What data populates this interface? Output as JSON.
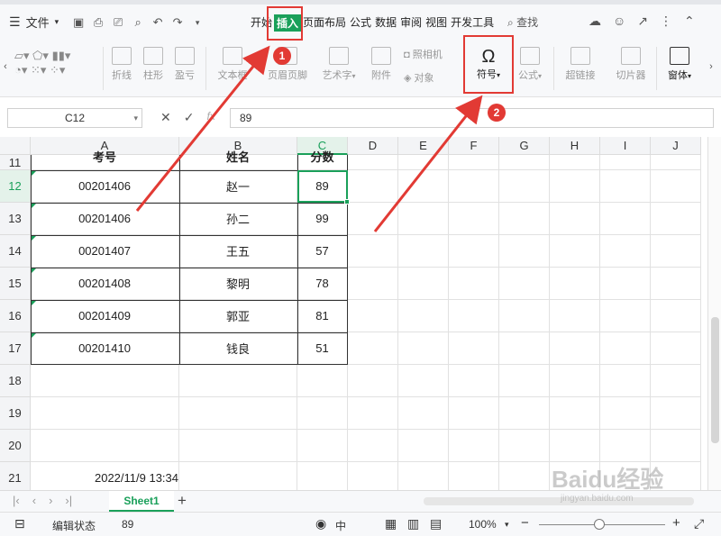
{
  "menubar": {
    "file_label": "文件",
    "tabs": [
      "开始",
      "插入",
      "页面布局",
      "公式",
      "数据",
      "审阅",
      "视图",
      "开发工具"
    ],
    "active_tab_index": 1,
    "search_label": "查找"
  },
  "ribbon": {
    "items": [
      {
        "label": "折线",
        "icon": "line-chart-icon"
      },
      {
        "label": "柱形",
        "icon": "bar-chart-icon"
      },
      {
        "label": "盈亏",
        "icon": "win-loss-icon"
      },
      {
        "label": "文本框",
        "icon": "textbox-icon"
      },
      {
        "label": "页眉页脚",
        "icon": "header-footer-icon"
      },
      {
        "label": "艺术字",
        "icon": "art-text-icon"
      },
      {
        "label": "附件",
        "icon": "attachment-icon"
      },
      {
        "label": "照相机",
        "icon": "camera-icon"
      },
      {
        "label": "对象",
        "icon": "object-icon"
      },
      {
        "label": "符号",
        "icon": "omega-icon"
      },
      {
        "label": "公式",
        "icon": "formula-icon"
      },
      {
        "label": "超链接",
        "icon": "hyperlink-icon"
      },
      {
        "label": "切片器",
        "icon": "slicer-icon"
      },
      {
        "label": "窗体",
        "icon": "form-icon"
      }
    ]
  },
  "formula_bar": {
    "name_box": "C12",
    "fx_label": "fx",
    "value": "89"
  },
  "sheet": {
    "columns": [
      "A",
      "B",
      "C",
      "D",
      "E",
      "F",
      "G",
      "H",
      "I",
      "J"
    ],
    "rows": [
      "11",
      "12",
      "13",
      "14",
      "15",
      "16",
      "17",
      "18",
      "19",
      "20",
      "21"
    ],
    "header_row_partial": [
      "考号",
      "姓名",
      "分数"
    ],
    "data": [
      [
        "00201406",
        "赵一",
        "89"
      ],
      [
        "00201406",
        "孙二",
        "99"
      ],
      [
        "00201407",
        "王五",
        "57"
      ],
      [
        "00201408",
        "黎明",
        "78"
      ],
      [
        "00201409",
        "郭亚",
        "81"
      ],
      [
        "00201410",
        "钱良",
        "51"
      ]
    ],
    "timestamp": "2022/11/9 13:34",
    "selected_cell": "C12"
  },
  "sheet_tabs": {
    "active": "Sheet1",
    "add_label": "+"
  },
  "statusbar": {
    "mode": "编辑状态",
    "value": "89",
    "zoom": "100%",
    "zoom_minus": "−",
    "zoom_plus": "+",
    "ime_label": "中"
  },
  "annotations": {
    "badge1": "1",
    "badge2": "2",
    "accent": "#e23a34"
  },
  "watermark": {
    "main": "Baidu经验",
    "sub": "jingyan.baidu.com"
  }
}
